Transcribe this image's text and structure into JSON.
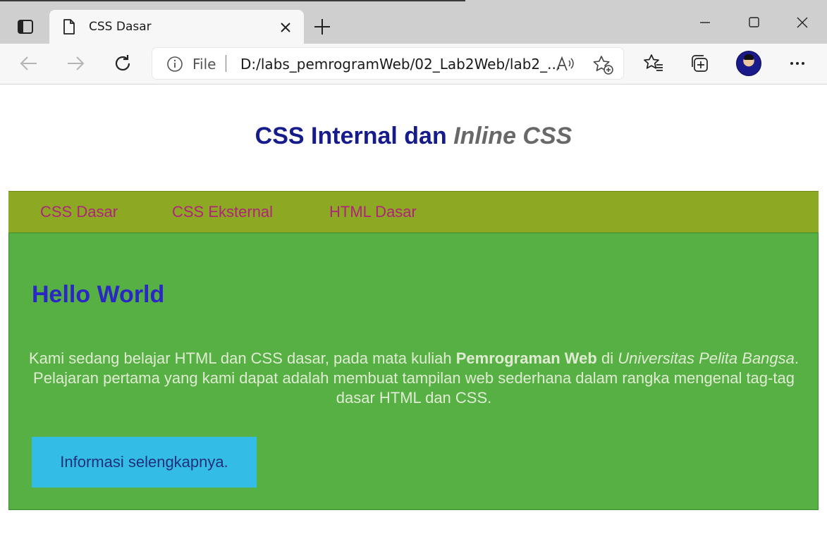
{
  "browser": {
    "tab": {
      "title": "CSS Dasar"
    },
    "address": {
      "scheme_label": "File",
      "url": "D:/labs_pemrogramWeb/02_Lab2Web/lab2_..."
    },
    "icons": {
      "tab_actions": "tab-actions-icon",
      "page": "page-icon",
      "tab_close": "close-icon",
      "new_tab": "plus-icon",
      "minimize": "minimize-icon",
      "maximize": "maximize-icon",
      "close": "close-icon",
      "back": "arrow-left-icon",
      "forward": "arrow-right-icon",
      "refresh": "refresh-icon",
      "info": "info-icon",
      "read_aloud": "read-aloud-icon",
      "add_favorite": "add-favorite-icon",
      "favorites": "favorites-icon",
      "collections": "collections-icon",
      "more": "more-icon"
    }
  },
  "page": {
    "heading": {
      "normal": "CSS Internal dan",
      "italic": "Inline CSS"
    },
    "nav": [
      "CSS Dasar",
      "CSS Eksternal",
      "HTML Dasar"
    ],
    "main": {
      "hello": "Hello World",
      "intro": {
        "part1": "Kami sedang belajar HTML dan CSS dasar, pada mata kuliah ",
        "bold": "Pemrograman Web",
        "part2": " di ",
        "italic": "Universitas Pelita Bangsa",
        "part3": ". Pelajaran pertama yang kami dapat adalah membuat tampilan web sederhana dalam rangka mengenal tag-tag dasar HTML dan CSS."
      },
      "button": "Informasi selengkapnya."
    }
  },
  "colors": {
    "heading": "#161c8c",
    "heading_italic": "#686868",
    "nav_bg": "#8da823",
    "nav_link": "#b0247a",
    "main_bg": "#56b043",
    "hello": "#2a27c4",
    "intro_text": "#e1ebd4",
    "button_bg": "#33bde6",
    "button_text": "#20307a"
  }
}
